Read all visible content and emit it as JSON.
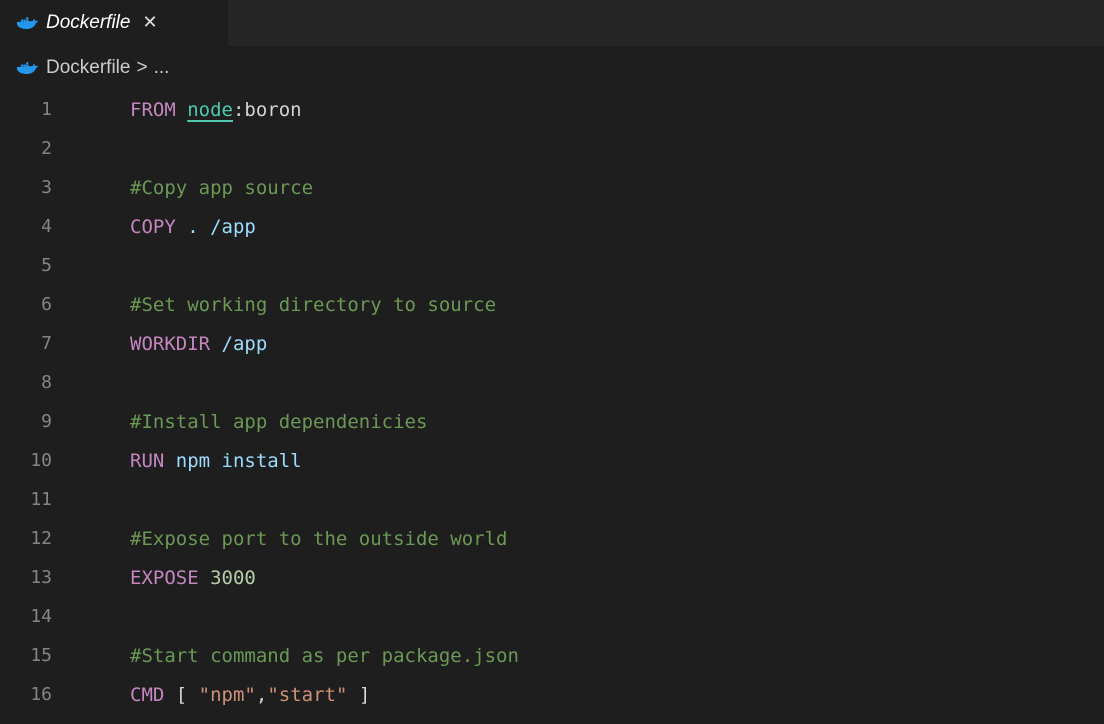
{
  "tab": {
    "label": "Dockerfile",
    "close": "✕"
  },
  "breadcrumb": {
    "file": "Dockerfile",
    "separator": ">",
    "rest": "..."
  },
  "editor": {
    "lines": [
      {
        "num": "1",
        "tokens": [
          {
            "t": "kw",
            "v": "FROM"
          },
          {
            "t": "pl",
            "v": " "
          },
          {
            "t": "fn ul",
            "v": "node"
          },
          {
            "t": "pl",
            "v": ":boron"
          }
        ]
      },
      {
        "num": "2",
        "tokens": []
      },
      {
        "num": "3",
        "tokens": [
          {
            "t": "cm",
            "v": "#Copy app source"
          }
        ]
      },
      {
        "num": "4",
        "tokens": [
          {
            "t": "kw",
            "v": "COPY"
          },
          {
            "t": "pl",
            "v": " "
          },
          {
            "t": "id",
            "v": ". /app"
          }
        ]
      },
      {
        "num": "5",
        "tokens": []
      },
      {
        "num": "6",
        "tokens": [
          {
            "t": "cm",
            "v": "#Set working directory to source"
          }
        ]
      },
      {
        "num": "7",
        "tokens": [
          {
            "t": "kw",
            "v": "WORKDIR"
          },
          {
            "t": "pl",
            "v": " "
          },
          {
            "t": "id",
            "v": "/app"
          }
        ]
      },
      {
        "num": "8",
        "tokens": []
      },
      {
        "num": "9",
        "tokens": [
          {
            "t": "cm",
            "v": "#Install app dependenicies"
          }
        ]
      },
      {
        "num": "10",
        "tokens": [
          {
            "t": "kw",
            "v": "RUN"
          },
          {
            "t": "pl",
            "v": " "
          },
          {
            "t": "id",
            "v": "npm install"
          }
        ]
      },
      {
        "num": "11",
        "tokens": []
      },
      {
        "num": "12",
        "tokens": [
          {
            "t": "cm",
            "v": "#Expose port to the outside world"
          }
        ]
      },
      {
        "num": "13",
        "tokens": [
          {
            "t": "kw",
            "v": "EXPOSE"
          },
          {
            "t": "pl",
            "v": " "
          },
          {
            "t": "num",
            "v": "3000"
          }
        ]
      },
      {
        "num": "14",
        "tokens": []
      },
      {
        "num": "15",
        "tokens": [
          {
            "t": "cm",
            "v": "#Start command as per package.json"
          }
        ]
      },
      {
        "num": "16",
        "tokens": [
          {
            "t": "kw",
            "v": "CMD"
          },
          {
            "t": "pl",
            "v": " [ "
          },
          {
            "t": "str",
            "v": "\"npm\""
          },
          {
            "t": "pl",
            "v": ","
          },
          {
            "t": "str",
            "v": "\"start\""
          },
          {
            "t": "pl",
            "v": " ]"
          }
        ]
      }
    ]
  },
  "icons": {
    "file_icon": "docker-icon"
  },
  "colors": {
    "keyword": "#c586c0",
    "comment": "#6a9955",
    "identifier": "#9cdcfe",
    "string": "#ce9178",
    "number": "#b5cea8",
    "type": "#4ec9b0"
  }
}
